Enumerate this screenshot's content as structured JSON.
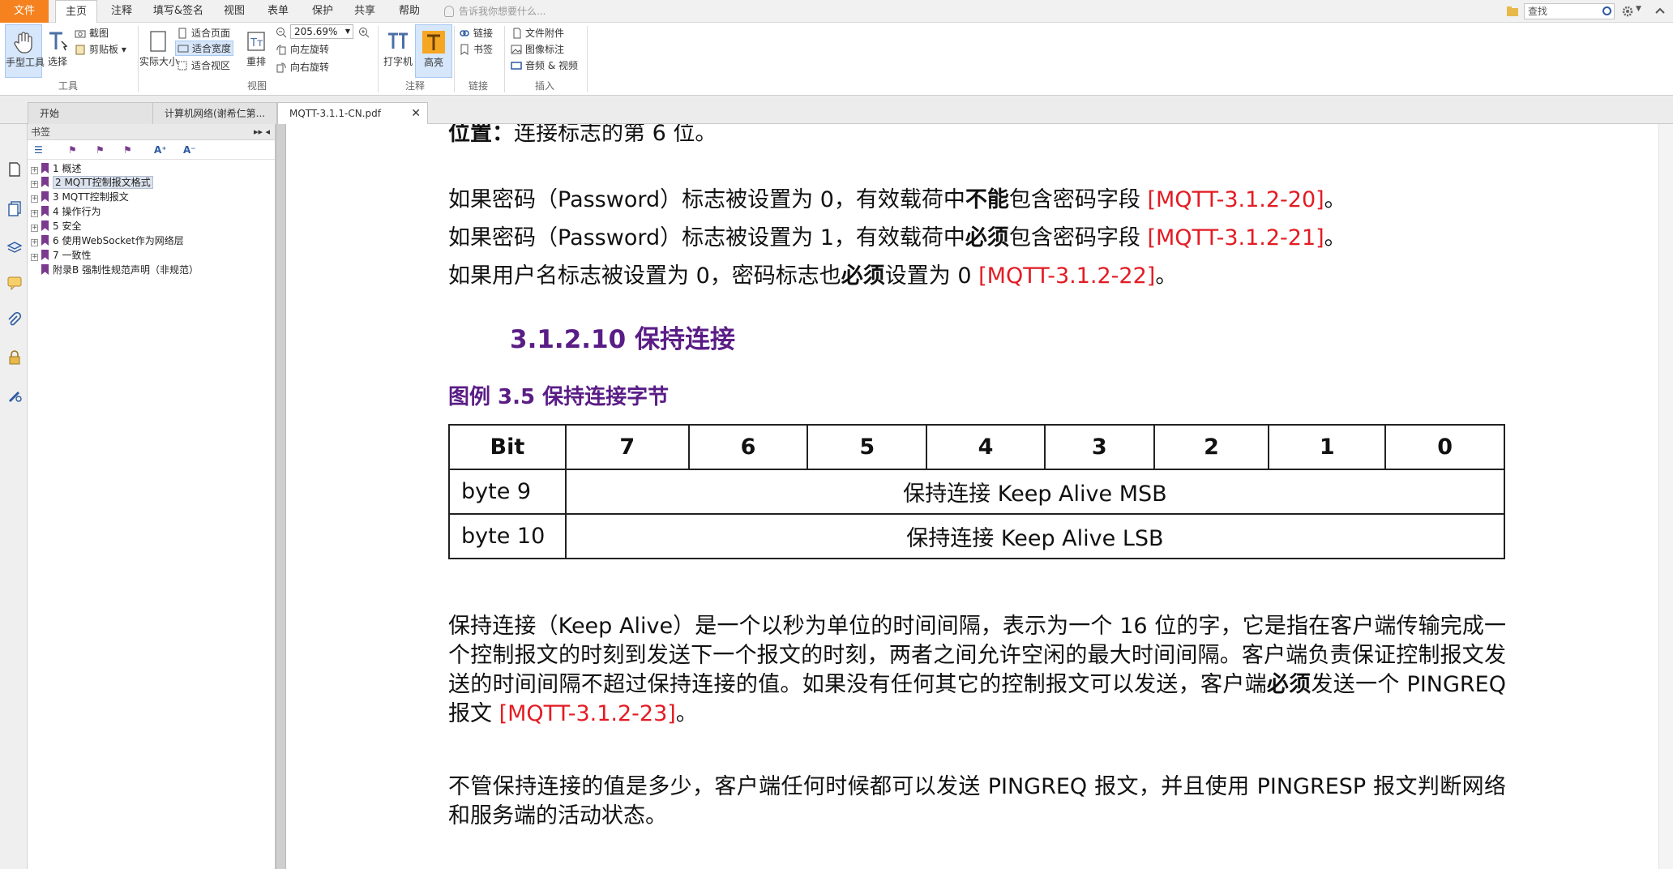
{
  "menu": {
    "tabs": [
      "文件",
      "主页",
      "注释",
      "填写&签名",
      "视图",
      "表单",
      "保护",
      "共享",
      "帮助"
    ],
    "ask_placeholder": "告诉我你想要什么...",
    "search_placeholder": "查找"
  },
  "ribbon": {
    "hand_tool": "手型工具",
    "select": "选择",
    "screenshot": "截图",
    "clipboard": "剪贴板",
    "actual_size": "实际大小",
    "fit_page": "适合页面",
    "fit_width": "适合宽度",
    "fit_visible": "适合视区",
    "reflow": "重排",
    "zoom_value": "205.69%",
    "rotate_left": "向左旋转",
    "rotate_right": "向右旋转",
    "typewriter": "打字机",
    "highlight": "高亮",
    "link": "链接",
    "bookmark": "书签",
    "file_attachment": "文件附件",
    "image_annotation": "图像标注",
    "audio_video": "音频 & 视频",
    "groups": {
      "tools": "工具",
      "view": "视图",
      "comment": "注释",
      "links": "链接",
      "insert": "插入"
    }
  },
  "doc_tabs": [
    "开始",
    "计算机网络(谢希仁第...",
    "MQTT-3.1.1-CN.pdf"
  ],
  "bookmarks": {
    "title": "书签",
    "items": [
      {
        "label": "1 概述"
      },
      {
        "label": "2 MQTT控制报文格式"
      },
      {
        "label": "3 MQTT控制报文"
      },
      {
        "label": "4 操作行为"
      },
      {
        "label": "5 安全"
      },
      {
        "label": "6 使用WebSocket作为网络层"
      },
      {
        "label": "7 一致性"
      },
      {
        "label": "附录B 强制性规范声明（非规范）"
      }
    ]
  },
  "doc": {
    "line0_bold": "位置：",
    "line0_rest": "连接标志的第 6 位。",
    "p1_a": "如果密码（Password）标志被设置为 0，有效载荷中",
    "p1_b": "不能",
    "p1_c": "包含密码字段 ",
    "p1_ref": "[MQTT-3.1.2-20]",
    "p1_end": "。",
    "p2_a": "如果密码（Password）标志被设置为 1，有效载荷中",
    "p2_b": "必须",
    "p2_c": "包含密码字段 ",
    "p2_ref": "[MQTT-3.1.2-21]",
    "p2_end": "。",
    "p3_a": "如果用户名标志被设置为 0，密码标志也",
    "p3_b": "必须",
    "p3_c": "设置为 0 ",
    "p3_ref": "[MQTT-3.1.2-22]",
    "p3_end": "。",
    "section_heading": "3.1.2.10 保持连接",
    "figure_caption": "图例 3.5 保持连接字节",
    "table": {
      "header": [
        "Bit",
        "7",
        "6",
        "5",
        "4",
        "3",
        "2",
        "1",
        "0"
      ],
      "rows": [
        {
          "label": "byte 9",
          "value": "保持连接 Keep Alive MSB"
        },
        {
          "label": "byte 10",
          "value": "保持连接 Keep Alive LSB"
        }
      ]
    },
    "para1_a": "保持连接（Keep Alive）是一个以秒为单位的时间间隔，表示为一个 16 位的字，它是指在客户端传输完成一个控制报文的时刻到发送下一个报文的时刻，两者之间允许空闲的最大时间间隔。客户端负责保证控制报文发送的时间间隔不超过保持连接的值。如果没有任何其它的控制报文可以发送，客户端",
    "para1_b": "必须",
    "para1_c": "发送一个 PINGREQ 报文 ",
    "para1_ref": "[MQTT-3.1.2-23]",
    "para1_end": "。",
    "para2": "不管保持连接的值是多少，客户端任何时候都可以发送 PINGREQ 报文，并且使用 PINGRESP 报文判断网络和服务端的活动状态。"
  },
  "colors": {
    "accent": "#f5821f",
    "heading": "#5a1d86",
    "reference": "#e31b23",
    "bookmark_flag": "#7b3a8e"
  }
}
